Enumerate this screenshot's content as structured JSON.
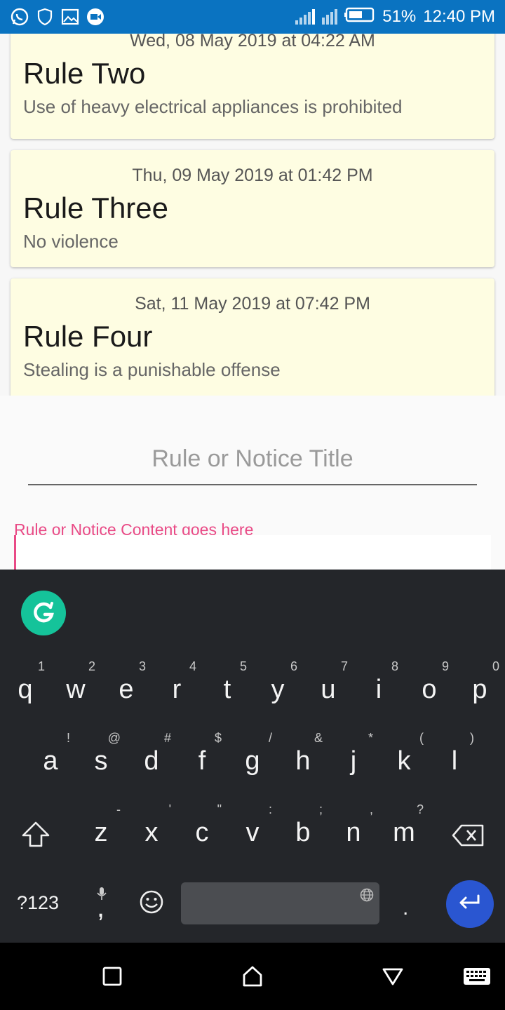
{
  "status_bar": {
    "battery": "51%",
    "time": "12:40 PM",
    "icons": [
      "whatsapp-icon",
      "shield-icon",
      "image-icon",
      "video-call-icon",
      "signal-icon",
      "battery-icon"
    ]
  },
  "cards": [
    {
      "date": "Wed, 08 May 2019 at 04:22 AM",
      "title": "Rule Two",
      "body": "Use of heavy electrical appliances is prohibited"
    },
    {
      "date": "Thu, 09 May 2019 at 01:42 PM",
      "title": "Rule Three",
      "body": "No violence"
    },
    {
      "date": "Sat, 11 May 2019 at 07:42 PM",
      "title": "Rule Four",
      "body": "Stealing is a punishable offense"
    }
  ],
  "form": {
    "title_placeholder": "Rule or Notice Title",
    "content_label": "Rule or Notice Content goes here",
    "accent_color": "#e94a86"
  },
  "keyboard": {
    "row1": [
      {
        "key": "q",
        "hint": "1"
      },
      {
        "key": "w",
        "hint": "2"
      },
      {
        "key": "e",
        "hint": "3"
      },
      {
        "key": "r",
        "hint": "4"
      },
      {
        "key": "t",
        "hint": "5"
      },
      {
        "key": "y",
        "hint": "6"
      },
      {
        "key": "u",
        "hint": "7"
      },
      {
        "key": "i",
        "hint": "8"
      },
      {
        "key": "o",
        "hint": "9"
      },
      {
        "key": "p",
        "hint": "0"
      }
    ],
    "row2": [
      {
        "key": "a",
        "hint": "!"
      },
      {
        "key": "s",
        "hint": "@"
      },
      {
        "key": "d",
        "hint": "#"
      },
      {
        "key": "f",
        "hint": "$"
      },
      {
        "key": "g",
        "hint": "/"
      },
      {
        "key": "h",
        "hint": "&"
      },
      {
        "key": "j",
        "hint": "*"
      },
      {
        "key": "k",
        "hint": "("
      },
      {
        "key": "l",
        "hint": ")"
      }
    ],
    "row3": [
      {
        "key": "z",
        "hint": "-"
      },
      {
        "key": "x",
        "hint": "'"
      },
      {
        "key": "c",
        "hint": "\""
      },
      {
        "key": "v",
        "hint": ":"
      },
      {
        "key": "b",
        "hint": ";"
      },
      {
        "key": "n",
        "hint": ","
      },
      {
        "key": "m",
        "hint": "?"
      }
    ],
    "symbols_label": "?123",
    "comma": ",",
    "period": ".",
    "enter_color": "#2a56d1",
    "grammarly_color": "#15c39a"
  },
  "nav": {
    "icons": [
      "recents-icon",
      "home-icon",
      "back-icon",
      "keyboard-switch-icon"
    ]
  }
}
